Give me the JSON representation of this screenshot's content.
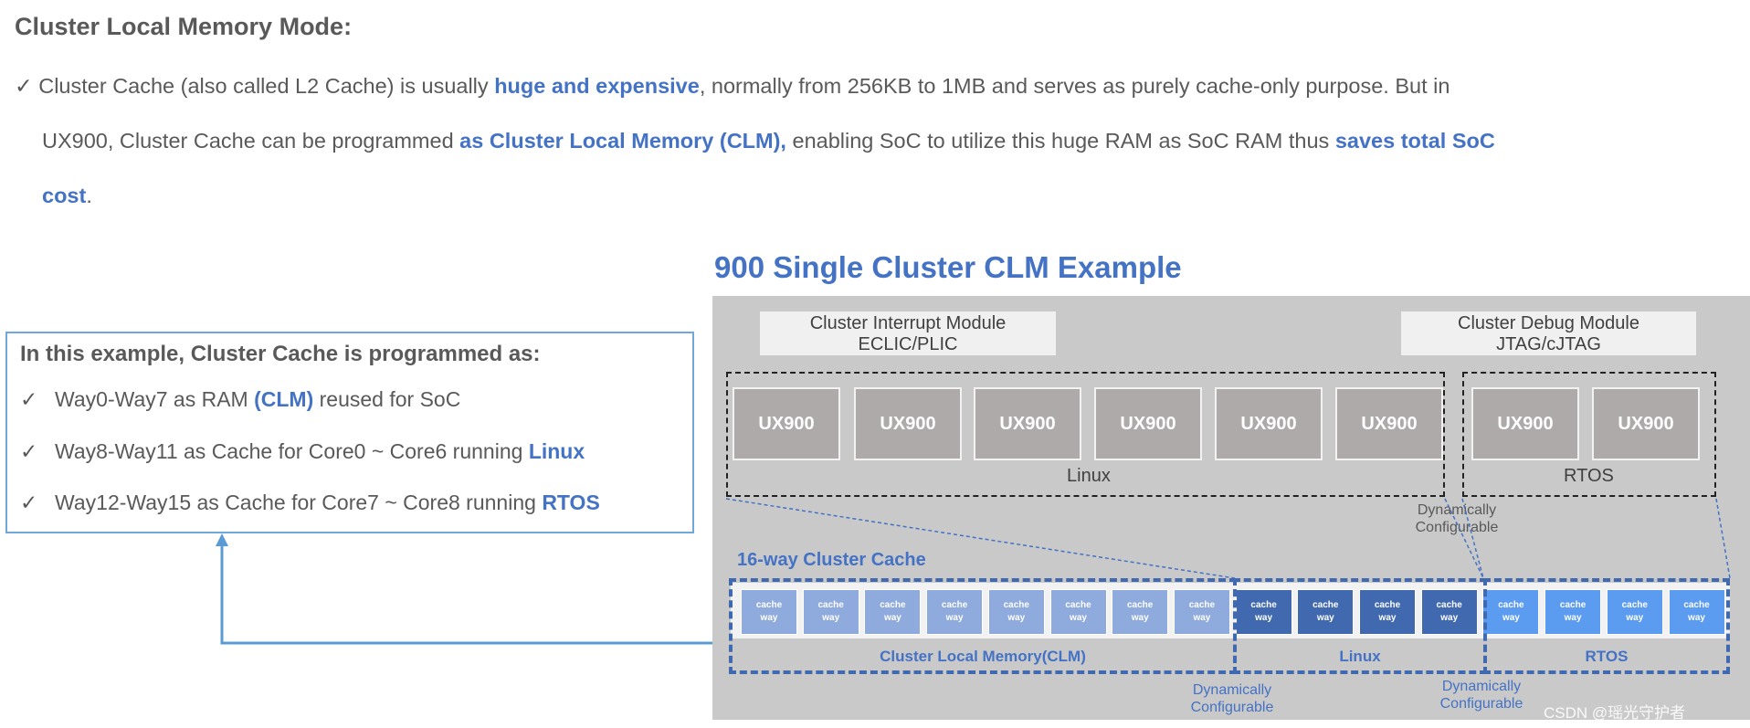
{
  "heading": "Cluster Local Memory Mode:",
  "check_icon": "✓",
  "paragraph": {
    "line1": {
      "a": "Cluster Cache (also called L2 Cache) is usually ",
      "b": "huge and expensive",
      "c": ", normally from 256KB to 1MB and serves as purely cache-only purpose. But in"
    },
    "line2": {
      "a": "UX900, Cluster Cache can be programmed ",
      "b": "as Cluster Local Memory (CLM),",
      "c": " enabling SoC to utilize this huge RAM as SoC RAM thus ",
      "d": "saves total SoC"
    },
    "line3": {
      "b": "cost",
      "c": "."
    }
  },
  "example_box": {
    "title": "In this example, Cluster Cache is programmed as:",
    "items": [
      {
        "a": "Way0-Way7 as RAM ",
        "b": "(CLM)",
        "c": "  reused for SoC"
      },
      {
        "a": "Way8-Way11 as Cache for  Core0 ~ Core6 running ",
        "b": "Linux",
        "c": ""
      },
      {
        "a": "Way12-Way15 as Cache for Core7 ~ Core8 running ",
        "b": "RTOS",
        "c": ""
      }
    ]
  },
  "diagram": {
    "title": "900 Single Cluster CLM Example",
    "interrupt_module": {
      "line1": "Cluster Interrupt Module",
      "line2": "ECLIC/PLIC"
    },
    "debug_module": {
      "line1": "Cluster Debug Module",
      "line2": "JTAG/cJTAG"
    },
    "core_label": "UX900",
    "linux_cores": 6,
    "rtos_cores": 2,
    "linux_label": "Linux",
    "rtos_label": "RTOS",
    "dynamic_line1": "Dynamically",
    "dynamic_line2": "Configurable",
    "cache_title": "16-way Cluster Cache",
    "cell_line1": "cache",
    "cell_line2": "way",
    "groups": [
      {
        "label": "Cluster Local Memory(CLM)",
        "ways": 8,
        "color": "#8faadc"
      },
      {
        "label": "Linux",
        "ways": 4,
        "color": "#4169b0"
      },
      {
        "label": "RTOS",
        "ways": 4,
        "color": "#5b9bf0"
      }
    ]
  },
  "watermark": "CSDN @瑶光守护者",
  "colors": {
    "accent": "#4472c4",
    "text": "#595959",
    "panel": "#c9c9c9",
    "arrow": "#5b9bd5"
  }
}
